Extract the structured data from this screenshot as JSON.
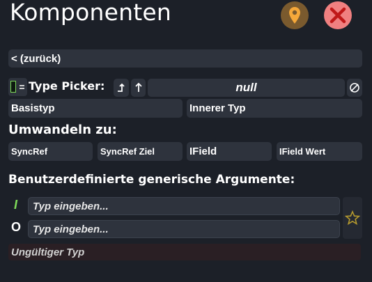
{
  "window": {
    "title": "Komponenten",
    "accent_pin": "#7a5a2e",
    "accent_close": "#f08080"
  },
  "nav": {
    "back_label": "< (zurück)"
  },
  "type_picker": {
    "label": "Type Picker:",
    "value": "null",
    "swatch_icon": "type-swatch-icon",
    "buttons": [
      "Basistyp",
      "Innerer Typ"
    ]
  },
  "convert": {
    "heading": "Umwandeln zu:",
    "options": [
      "SyncRef",
      "SyncRef Ziel",
      "IField",
      "IField Wert"
    ]
  },
  "generics": {
    "heading": "Benutzerdefinierte generische Argumente:",
    "args": [
      {
        "marker": "I",
        "placeholder": "Typ eingeben..."
      },
      {
        "marker": "O",
        "placeholder": "Typ eingeben..."
      }
    ],
    "status": "Ungültiger Typ"
  }
}
